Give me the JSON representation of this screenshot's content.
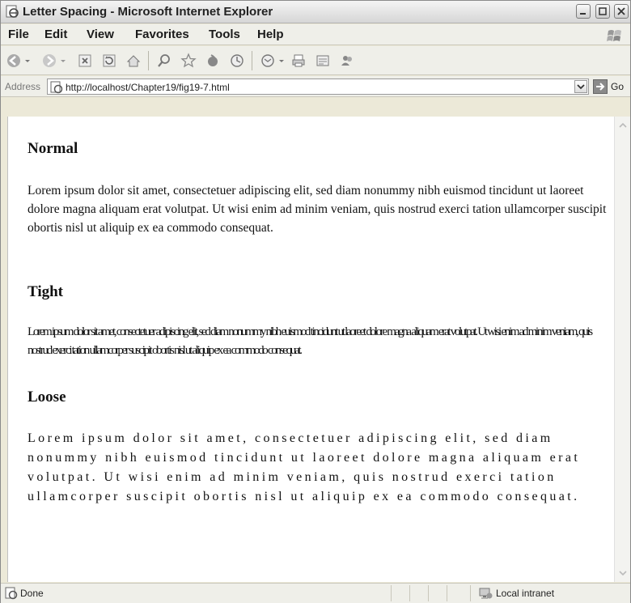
{
  "window": {
    "title": "Letter Spacing - Microsoft Internet Explorer"
  },
  "menu": {
    "file": "File",
    "edit": "Edit",
    "view": "View",
    "favorites": "Favorites",
    "tools": "Tools",
    "help": "Help"
  },
  "toolbar": {
    "icons": [
      "back-icon",
      "back-dropdown-icon",
      "forward-icon",
      "forward-dropdown-icon",
      "stop-icon",
      "refresh-icon",
      "home-icon",
      "search-icon",
      "favorites-icon",
      "media-icon",
      "history-icon",
      "mail-icon",
      "mail-dropdown-icon",
      "print-icon",
      "edit-icon",
      "messenger-icon"
    ]
  },
  "address": {
    "label": "Address",
    "url": "http://localhost/Chapter19/fig19-7.html",
    "go_label": "Go"
  },
  "page": {
    "normal_heading": "Normal",
    "normal_text": "Lorem ipsum dolor sit amet, consectetuer adipiscing elit, sed diam nonummy nibh euismod tincidunt ut laoreet dolore magna aliquam erat volutpat. Ut wisi enim ad minim veniam, quis nostrud exerci tation ullamcorper suscipit obortis nisl ut aliquip ex ea commodo consequat.",
    "tight_heading": "Tight",
    "tight_text": "Lorem ipsum dolor sit amet, consectetuer adipiscing elit, sed diam nonummy nibh euismod tincidunt ut laoreet dolore magna aliquam erat volutpat. Ut wisi enim ad minim veniam, quis nostrud exerci tation ullamcorper suscipit obortis nisl ut aliquip ex ea commodo consequat.",
    "loose_heading": "Loose",
    "loose_text": "Lorem ipsum dolor sit amet, consectetuer adipiscing elit, sed diam nonummy nibh euismod tincidunt ut laoreet dolore magna aliquam erat volutpat. Ut wisi enim ad minim veniam, quis nostrud exerci tation ullamcorper suscipit obortis nisl ut aliquip ex ea commodo consequat."
  },
  "status": {
    "text": "Done",
    "zone": "Local intranet"
  },
  "colors": {
    "chrome": "#ece9d8",
    "page_bg": "#ffffff",
    "text": "#111111"
  }
}
